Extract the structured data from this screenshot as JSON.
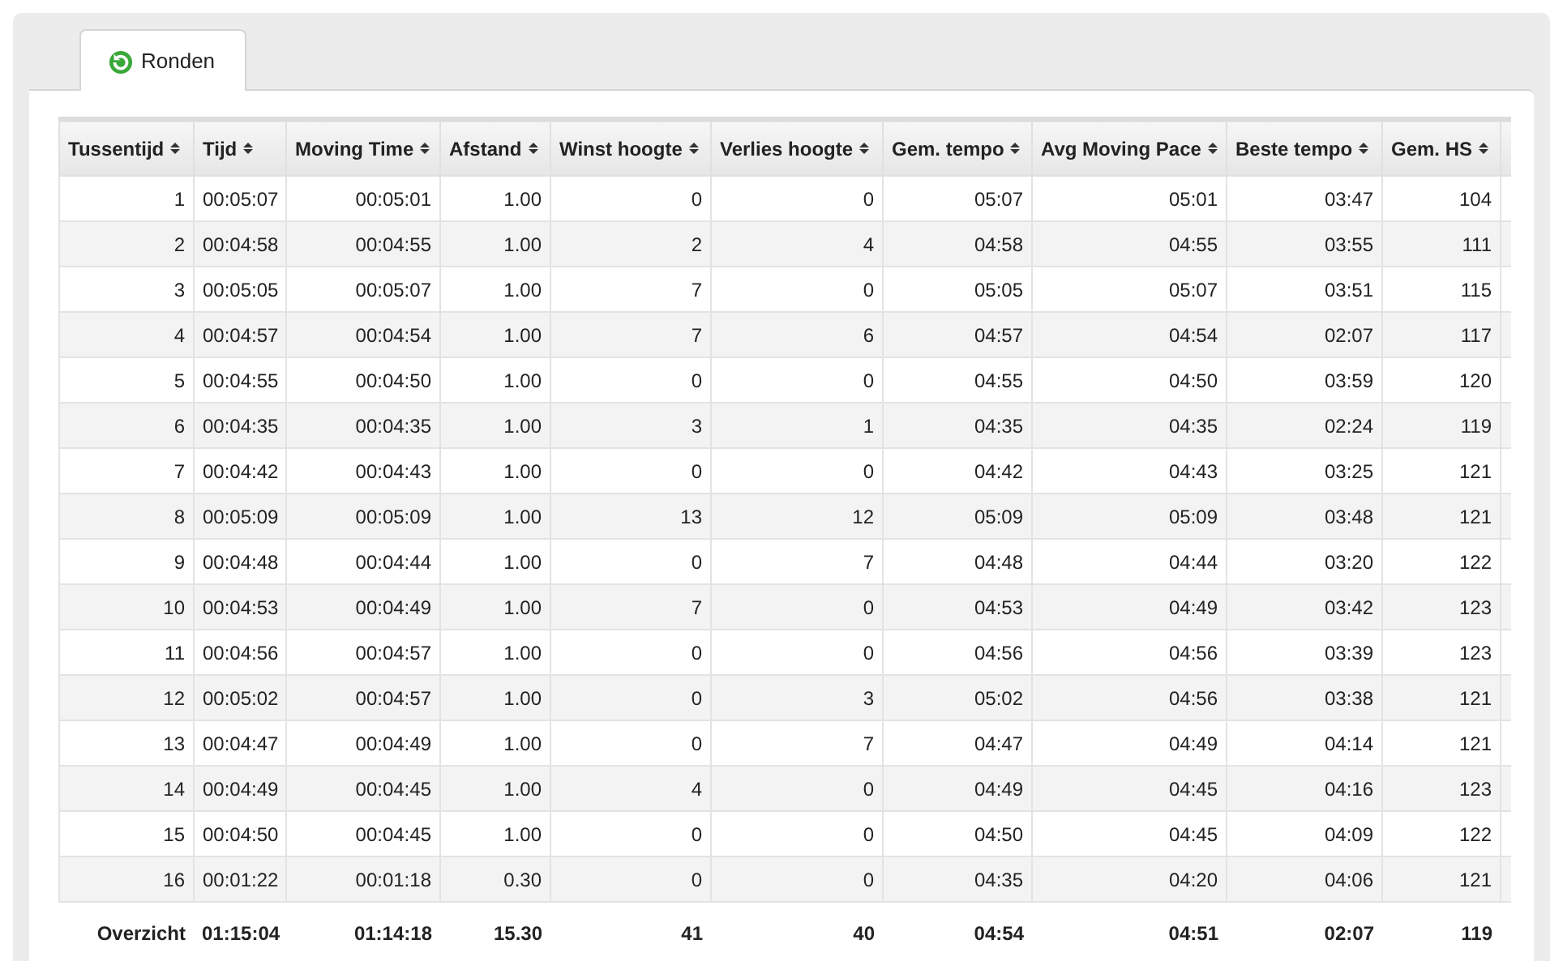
{
  "tabs": [
    {
      "label": "Ronden",
      "selected": true
    }
  ],
  "table": {
    "columns": [
      "Tussentijd",
      "Tijd",
      "Moving Time",
      "Afstand",
      "Winst hoogte",
      "Verlies hoogte",
      "Gem. tempo",
      "Avg Moving Pace",
      "Beste tempo",
      "Gem. HS"
    ],
    "rows": [
      [
        "1",
        "00:05:07",
        "00:05:01",
        "1.00",
        "0",
        "0",
        "05:07",
        "05:01",
        "03:47",
        "104"
      ],
      [
        "2",
        "00:04:58",
        "00:04:55",
        "1.00",
        "2",
        "4",
        "04:58",
        "04:55",
        "03:55",
        "111"
      ],
      [
        "3",
        "00:05:05",
        "00:05:07",
        "1.00",
        "7",
        "0",
        "05:05",
        "05:07",
        "03:51",
        "115"
      ],
      [
        "4",
        "00:04:57",
        "00:04:54",
        "1.00",
        "7",
        "6",
        "04:57",
        "04:54",
        "02:07",
        "117"
      ],
      [
        "5",
        "00:04:55",
        "00:04:50",
        "1.00",
        "0",
        "0",
        "04:55",
        "04:50",
        "03:59",
        "120"
      ],
      [
        "6",
        "00:04:35",
        "00:04:35",
        "1.00",
        "3",
        "1",
        "04:35",
        "04:35",
        "02:24",
        "119"
      ],
      [
        "7",
        "00:04:42",
        "00:04:43",
        "1.00",
        "0",
        "0",
        "04:42",
        "04:43",
        "03:25",
        "121"
      ],
      [
        "8",
        "00:05:09",
        "00:05:09",
        "1.00",
        "13",
        "12",
        "05:09",
        "05:09",
        "03:48",
        "121"
      ],
      [
        "9",
        "00:04:48",
        "00:04:44",
        "1.00",
        "0",
        "7",
        "04:48",
        "04:44",
        "03:20",
        "122"
      ],
      [
        "10",
        "00:04:53",
        "00:04:49",
        "1.00",
        "7",
        "0",
        "04:53",
        "04:49",
        "03:42",
        "123"
      ],
      [
        "11",
        "00:04:56",
        "00:04:57",
        "1.00",
        "0",
        "0",
        "04:56",
        "04:56",
        "03:39",
        "123"
      ],
      [
        "12",
        "00:05:02",
        "00:04:57",
        "1.00",
        "0",
        "3",
        "05:02",
        "04:56",
        "03:38",
        "121"
      ],
      [
        "13",
        "00:04:47",
        "00:04:49",
        "1.00",
        "0",
        "7",
        "04:47",
        "04:49",
        "04:14",
        "121"
      ],
      [
        "14",
        "00:04:49",
        "00:04:45",
        "1.00",
        "4",
        "0",
        "04:49",
        "04:45",
        "04:16",
        "123"
      ],
      [
        "15",
        "00:04:50",
        "00:04:45",
        "1.00",
        "0",
        "0",
        "04:50",
        "04:45",
        "04:09",
        "122"
      ],
      [
        "16",
        "00:01:22",
        "00:01:18",
        "0.30",
        "0",
        "0",
        "04:35",
        "04:20",
        "04:06",
        "121"
      ]
    ],
    "summary": [
      "Overzicht",
      "01:15:04",
      "01:14:18",
      "15.30",
      "41",
      "40",
      "04:54",
      "04:51",
      "02:07",
      "119"
    ]
  }
}
